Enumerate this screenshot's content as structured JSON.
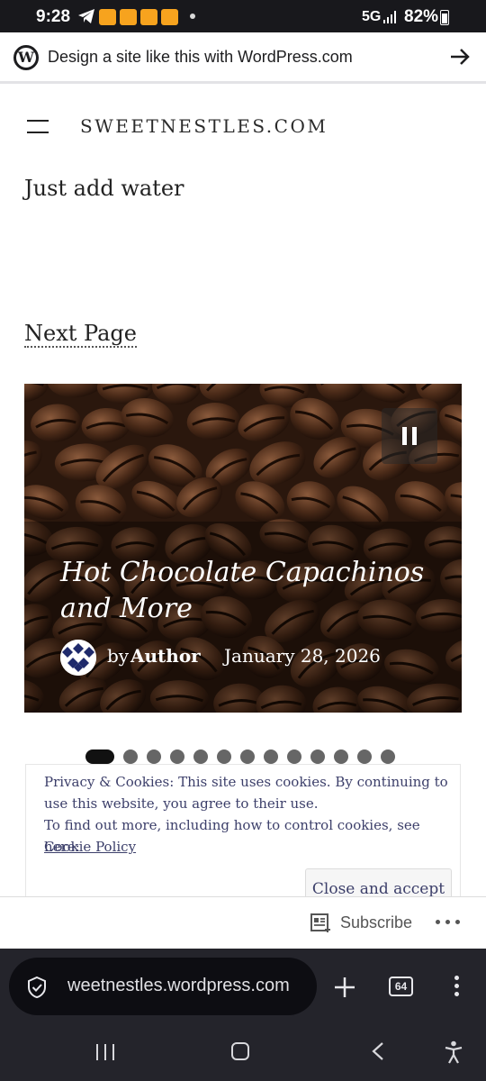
{
  "status_bar": {
    "time": "9:28",
    "network": "5G",
    "battery": "82%",
    "notification_icons": [
      "telegram-icon",
      "app-icon",
      "app-icon",
      "app-icon",
      "app-icon"
    ]
  },
  "wp_banner": {
    "text": "Design a site like this with WordPress.com"
  },
  "header": {
    "site_title": "SWEETNESTLES.COM"
  },
  "content": {
    "tagline": "Just add water",
    "next_page": "Next Page"
  },
  "slide": {
    "title": "Hot Chocolate Capachinos and More",
    "by": "by",
    "author": "Author",
    "date": "January 28, 2026",
    "total_slides": 13,
    "active_slide": 1
  },
  "cookie": {
    "line1": "Privacy & Cookies: This site uses cookies. By continuing to use this website, you agree to their use.",
    "line2": "To find out more, including how to control cookies, see here:",
    "link": "Cookie Policy",
    "accept": "Close and accept"
  },
  "subscribe_bar": {
    "label": "Subscribe"
  },
  "browser": {
    "url": "weetnestles.wordpress.com",
    "tab_count": "64"
  },
  "colors": {
    "cookie_text": "#3c3f6a",
    "status_bar": "#18181c",
    "browser_bar": "#24242b"
  }
}
